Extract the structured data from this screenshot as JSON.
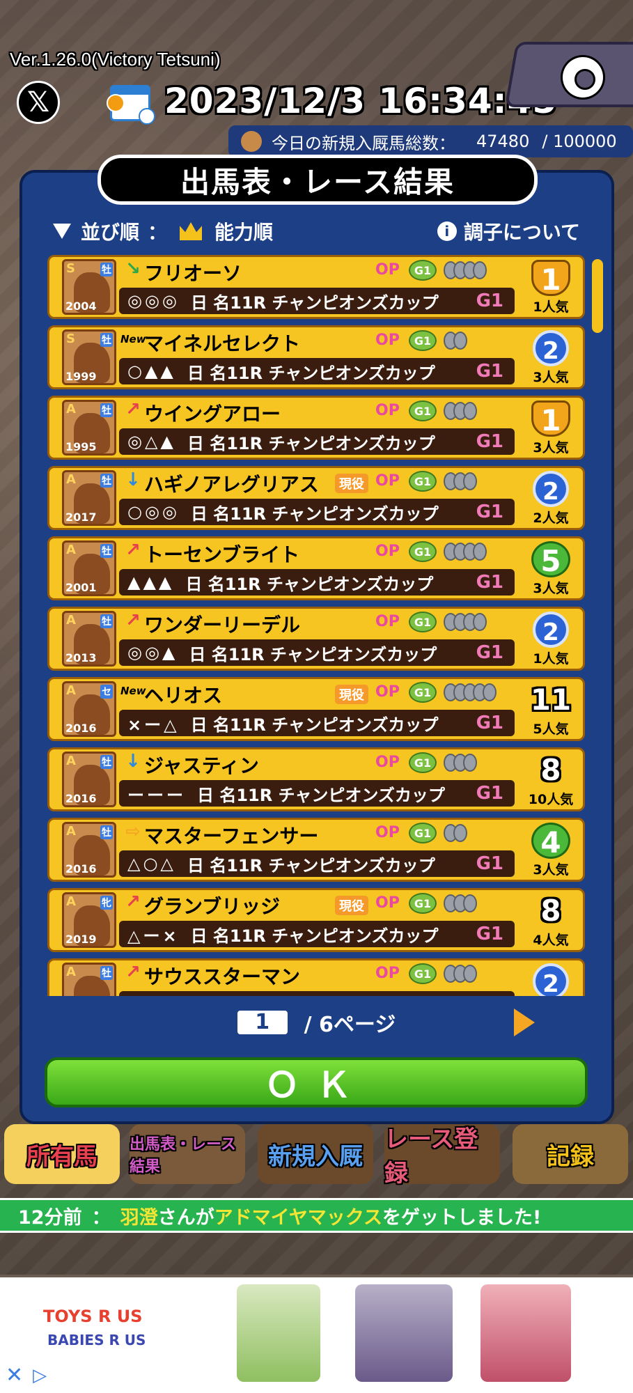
{
  "header": {
    "version": "Ver.1.26.0(Victory Tetsuni)",
    "x_label": "𝕏",
    "datetime": "2023/12/3 16:34:45",
    "count_label": "今日の新規入厩馬総数：",
    "count_value": "47480",
    "count_max": "/ 100000"
  },
  "panel": {
    "title": "出馬表・レース結果",
    "sort_label": "並び順",
    "sort_sep": "：",
    "sort_value": "能力順",
    "info_label": "調子について"
  },
  "horses": [
    {
      "rank": "S",
      "sex": "牡",
      "year": "2004",
      "cond": "↘",
      "cond_color": "#2fa84a",
      "new": "",
      "name": "フリオーソ",
      "genki": "",
      "shoes": 4,
      "marks": "◎◎◎",
      "race": "日 名11R チャンピオンズカップ",
      "grade": "G1",
      "place": "1",
      "place_style": "gold",
      "pop": "1人気"
    },
    {
      "rank": "S",
      "sex": "牡",
      "year": "1999",
      "cond": "",
      "cond_color": "#000",
      "new": "New",
      "name": "マイネルセレクト",
      "genki": "",
      "shoes": 2,
      "marks": "○▲▲",
      "race": "日 名11R チャンピオンズカップ",
      "grade": "G1",
      "place": "2",
      "place_style": "blue",
      "pop": "3人気"
    },
    {
      "rank": "A",
      "sex": "牡",
      "year": "1995",
      "cond": "↗",
      "cond_color": "#e8404f",
      "new": "",
      "name": "ウイングアロー",
      "genki": "",
      "shoes": 3,
      "marks": "◎△▲",
      "race": "日 名11R チャンピオンズカップ",
      "grade": "G1",
      "place": "1",
      "place_style": "gold",
      "pop": "3人気"
    },
    {
      "rank": "A",
      "sex": "牡",
      "year": "2017",
      "cond": "↓",
      "cond_color": "#2c8ae0",
      "new": "",
      "name": "ハギノアレグリアス",
      "genki": "現役",
      "shoes": 3,
      "marks": "○◎◎",
      "race": "日 名11R チャンピオンズカップ",
      "grade": "G1",
      "place": "2",
      "place_style": "blue",
      "pop": "2人気"
    },
    {
      "rank": "A",
      "sex": "牡",
      "year": "2001",
      "cond": "↗",
      "cond_color": "#e8404f",
      "new": "",
      "name": "トーセンブライト",
      "genki": "",
      "shoes": 4,
      "marks": "▲▲▲",
      "race": "日 名11R チャンピオンズカップ",
      "grade": "G1",
      "place": "5",
      "place_style": "green",
      "pop": "3人気"
    },
    {
      "rank": "A",
      "sex": "牡",
      "year": "2013",
      "cond": "↗",
      "cond_color": "#e8404f",
      "new": "",
      "name": "ワンダーリーデル",
      "genki": "",
      "shoes": 4,
      "marks": "◎◎▲",
      "race": "日 名11R チャンピオンズカップ",
      "grade": "G1",
      "place": "2",
      "place_style": "blue",
      "pop": "1人気"
    },
    {
      "rank": "A",
      "sex": "セ",
      "year": "2016",
      "cond": "",
      "cond_color": "#000",
      "new": "New",
      "name": "ヘリオス",
      "genki": "現役",
      "shoes": 5,
      "marks": "×ー△",
      "race": "日 名11R チャンピオンズカップ",
      "grade": "G1",
      "place": "11",
      "place_style": "plain",
      "pop": "5人気"
    },
    {
      "rank": "A",
      "sex": "牡",
      "year": "2016",
      "cond": "↓",
      "cond_color": "#2c8ae0",
      "new": "",
      "name": "ジャスティン",
      "genki": "",
      "shoes": 3,
      "marks": "ーーー",
      "race": "日 名11R チャンピオンズカップ",
      "grade": "G1",
      "place": "8",
      "place_style": "plain",
      "pop": "10人気"
    },
    {
      "rank": "A",
      "sex": "牡",
      "year": "2016",
      "cond": "⇨",
      "cond_color": "#f5a623",
      "new": "",
      "name": "マスターフェンサー",
      "genki": "",
      "shoes": 2,
      "marks": "△○△",
      "race": "日 名11R チャンピオンズカップ",
      "grade": "G1",
      "place": "4",
      "place_style": "green",
      "pop": "3人気"
    },
    {
      "rank": "A",
      "sex": "牝",
      "year": "2019",
      "cond": "↗",
      "cond_color": "#e8404f",
      "new": "",
      "name": "グランブリッジ",
      "genki": "現役",
      "shoes": 3,
      "marks": "△ー×",
      "race": "日 名11R チャンピオンズカップ",
      "grade": "G1",
      "place": "8",
      "place_style": "plain",
      "pop": "4人気"
    },
    {
      "rank": "A",
      "sex": "牡",
      "year": "",
      "cond": "↗",
      "cond_color": "#e8404f",
      "new": "",
      "name": "サウススターマン",
      "genki": "",
      "shoes": 3,
      "marks": "",
      "race": "",
      "grade": "",
      "place": "2",
      "place_style": "blue",
      "pop": ""
    }
  ],
  "pager": {
    "current": "1",
    "total": "/ 6ページ"
  },
  "ok_label": "ＯＫ",
  "nav": [
    {
      "label": "所有馬",
      "color": "#e8404f",
      "bg": "#f5d05c"
    },
    {
      "label": "出馬表・レース結果",
      "color": "#d45cc8",
      "bg": "#7a5a3a"
    },
    {
      "label": "新規入厩",
      "color": "#5aa0f0",
      "bg": "#6a4a2a"
    },
    {
      "label": "レース登録",
      "color": "#e85a7a",
      "bg": "#6a4a2a"
    },
    {
      "label": "記録",
      "color": "#f5c21b",
      "bg": "#8a6a3a"
    }
  ],
  "ticker": {
    "time": "12分前",
    "sep": "：",
    "user": "羽澄",
    "mid": "さんが",
    "horse": "アドマイヤマックス",
    "tail": "をゲットしました!"
  },
  "ad": {
    "brand1": "TOYS R US",
    "brand2": "BABIES R US"
  }
}
